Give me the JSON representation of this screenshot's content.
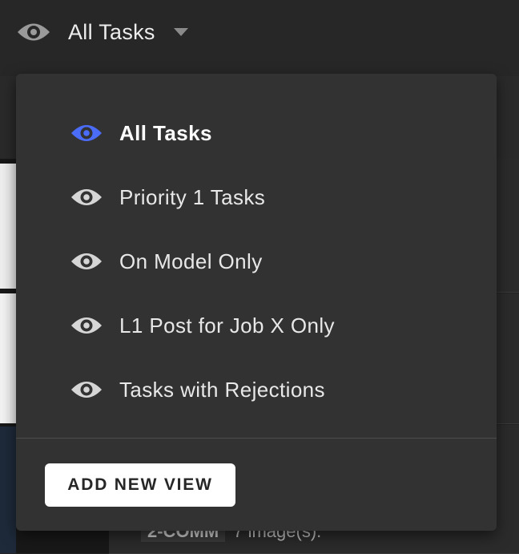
{
  "header": {
    "current_view": "All Tasks",
    "icon": "eye-icon",
    "caret_icon": "caret-down-icon",
    "icon_color": "#9a9a9a"
  },
  "dropdown": {
    "items": [
      {
        "label": "All Tasks",
        "active": true,
        "icon": "eye-icon",
        "icon_color": "#4a6cf7"
      },
      {
        "label": "Priority 1 Tasks",
        "active": false,
        "icon": "eye-icon",
        "icon_color": "#d6d6d6"
      },
      {
        "label": "On Model Only",
        "active": false,
        "icon": "eye-icon",
        "icon_color": "#d6d6d6"
      },
      {
        "label": "L1 Post for Job X Only",
        "active": false,
        "icon": "eye-icon",
        "icon_color": "#d6d6d6"
      },
      {
        "label": "Tasks with Rejections",
        "active": false,
        "icon": "eye-icon",
        "icon_color": "#d6d6d6"
      }
    ],
    "add_button_label": "ADD NEW VIEW"
  },
  "background": {
    "peek_chip": "2-COMM",
    "peek_text": "7 image(s)."
  }
}
